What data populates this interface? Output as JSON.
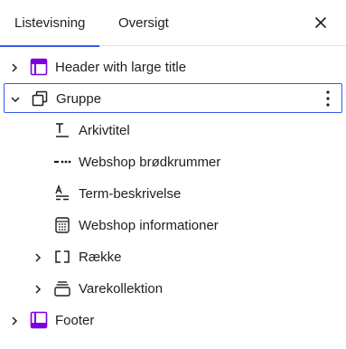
{
  "tabs": [
    {
      "label": "Listevisning",
      "active": true
    },
    {
      "label": "Oversigt",
      "active": false
    }
  ],
  "close_icon": "close-icon",
  "accent_color": "#3858e9",
  "block_icon_color": "#7a00df",
  "blocks": [
    {
      "label": "Header with large title",
      "icon": "template-part-header-icon",
      "expandable": true,
      "expanded": false
    },
    {
      "label": "Gruppe",
      "icon": "group-icon",
      "expandable": true,
      "expanded": true,
      "selected": true,
      "options_icon": "more-vertical-icon"
    },
    {
      "label": "Arkivtitel",
      "icon": "archive-title-icon"
    },
    {
      "label": "Webshop brødkrummer",
      "icon": "breadcrumbs-icon"
    },
    {
      "label": "Term-beskrivelse",
      "icon": "term-description-icon"
    },
    {
      "label": "Webshop informationer",
      "icon": "store-notices-icon"
    },
    {
      "label": "Række",
      "icon": "row-icon",
      "expandable": true,
      "expanded": false
    },
    {
      "label": "Varekollektion",
      "icon": "product-collection-icon",
      "expandable": true,
      "expanded": false
    },
    {
      "label": "Footer",
      "icon": "template-part-footer-icon",
      "expandable": true,
      "expanded": false
    }
  ]
}
